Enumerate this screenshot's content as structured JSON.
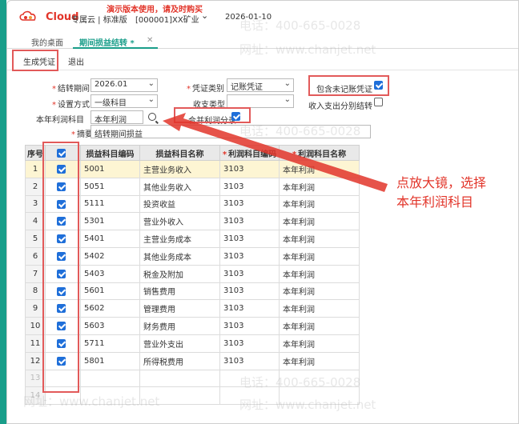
{
  "header": {
    "logo_text": "Cloud",
    "app_name": "专属云 | 标准版",
    "company": "[000001]XX矿业",
    "date": "2026-01-10",
    "demo_notice": "演示版本使用，请及时购买"
  },
  "tabs": {
    "home": "我的桌面",
    "active": "期间损益结转 *",
    "close": "✕"
  },
  "toolbar": {
    "generate": "生成凭证",
    "exit": "退出"
  },
  "form": {
    "period_label": "结转期间",
    "period_value": "2026.01",
    "voucher_type_label": "凭证类别",
    "voucher_type_value": "记账凭证",
    "include_unposted_label": "包含未记账凭证",
    "include_unposted_checked": true,
    "setup_label": "设置方式",
    "setup_value": "一级科目",
    "income_type_label": "收支类型",
    "income_type_value": "",
    "split_income_label": "收入支出分别结转",
    "split_income_checked": false,
    "profit_account_label": "本年利润科目",
    "profit_account_value": "本年利润",
    "merge_label": "合并利润分录",
    "merge_checked": true,
    "summary_label": "摘要",
    "summary_value": "结转期间损益"
  },
  "table": {
    "columns": [
      "序号",
      "",
      "损益科目编码",
      "损益科目名称",
      "利润科目编码",
      "利润科目名称"
    ],
    "rows": [
      {
        "no": "1",
        "checked": true,
        "code": "5001",
        "name": "主营业务收入",
        "profit_code": "3103",
        "profit_name": "本年利润"
      },
      {
        "no": "2",
        "checked": true,
        "code": "5051",
        "name": "其他业务收入",
        "profit_code": "3103",
        "profit_name": "本年利润"
      },
      {
        "no": "3",
        "checked": true,
        "code": "5111",
        "name": "投资收益",
        "profit_code": "3103",
        "profit_name": "本年利润"
      },
      {
        "no": "4",
        "checked": true,
        "code": "5301",
        "name": "营业外收入",
        "profit_code": "3103",
        "profit_name": "本年利润"
      },
      {
        "no": "5",
        "checked": true,
        "code": "5401",
        "name": "主营业务成本",
        "profit_code": "3103",
        "profit_name": "本年利润"
      },
      {
        "no": "6",
        "checked": true,
        "code": "5402",
        "name": "其他业务成本",
        "profit_code": "3103",
        "profit_name": "本年利润"
      },
      {
        "no": "7",
        "checked": true,
        "code": "5403",
        "name": "税金及附加",
        "profit_code": "3103",
        "profit_name": "本年利润"
      },
      {
        "no": "8",
        "checked": true,
        "code": "5601",
        "name": "销售费用",
        "profit_code": "3103",
        "profit_name": "本年利润"
      },
      {
        "no": "9",
        "checked": true,
        "code": "5602",
        "name": "管理费用",
        "profit_code": "3103",
        "profit_name": "本年利润"
      },
      {
        "no": "10",
        "checked": true,
        "code": "5603",
        "name": "财务费用",
        "profit_code": "3103",
        "profit_name": "本年利润"
      },
      {
        "no": "11",
        "checked": true,
        "code": "5711",
        "name": "营业外支出",
        "profit_code": "3103",
        "profit_name": "本年利润"
      },
      {
        "no": "12",
        "checked": true,
        "code": "5801",
        "name": "所得税费用",
        "profit_code": "3103",
        "profit_name": "本年利润"
      },
      {
        "no": "13",
        "checked": false,
        "code": "",
        "name": "",
        "profit_code": "",
        "profit_name": ""
      },
      {
        "no": "14",
        "checked": false,
        "code": "",
        "name": "",
        "profit_code": "",
        "profit_name": ""
      }
    ]
  },
  "annotation": {
    "line1": "点放大镜，选择",
    "line2": "本年利润科目"
  },
  "watermark": {
    "phone": "电话：400-665-0028",
    "site": "网址：www.chanjet.net"
  },
  "colors": {
    "accent": "#1a9e8a",
    "highlight": "#e25a5a",
    "checkbox": "#1f6fd9",
    "annotation": "#e2352a"
  }
}
